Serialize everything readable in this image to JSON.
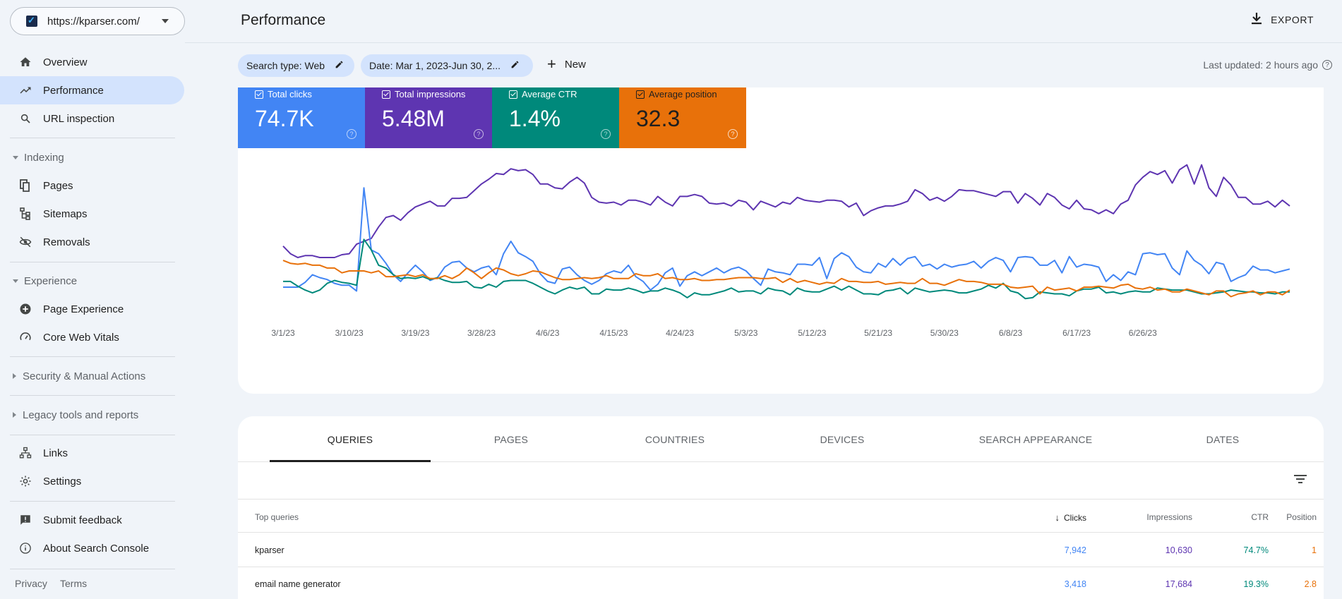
{
  "sidebar": {
    "property_url": "https://kparser.com/",
    "items_top": [
      {
        "label": "Overview",
        "icon": "home-icon"
      },
      {
        "label": "Performance",
        "icon": "trending-up-icon",
        "active": true
      },
      {
        "label": "URL inspection",
        "icon": "search-icon"
      }
    ],
    "indexing": {
      "header": "Indexing",
      "items": [
        {
          "label": "Pages",
          "icon": "pages-icon"
        },
        {
          "label": "Sitemaps",
          "icon": "sitemap-icon"
        },
        {
          "label": "Removals",
          "icon": "visibility-off-icon"
        }
      ]
    },
    "experience": {
      "header": "Experience",
      "items": [
        {
          "label": "Page Experience",
          "icon": "plus-circle-icon"
        },
        {
          "label": "Core Web Vitals",
          "icon": "gauge-icon"
        }
      ]
    },
    "security_header": "Security & Manual Actions",
    "legacy_header": "Legacy tools and reports",
    "items_bottom": [
      {
        "label": "Links",
        "icon": "links-icon"
      },
      {
        "label": "Settings",
        "icon": "gear-icon"
      }
    ],
    "items_footer": [
      {
        "label": "Submit feedback",
        "icon": "feedback-icon"
      },
      {
        "label": "About Search Console",
        "icon": "info-icon"
      }
    ],
    "privacy": "Privacy",
    "terms": "Terms"
  },
  "header": {
    "title": "Performance",
    "export_label": "EXPORT"
  },
  "filters": {
    "search_type": "Search type: Web",
    "date": "Date: Mar 1, 2023-Jun 30, 2...",
    "new_label": "New",
    "last_updated": "Last updated: 2 hours ago"
  },
  "metrics": [
    {
      "label": "Total clicks",
      "value": "74.7K",
      "color": "#4285f4"
    },
    {
      "label": "Total impressions",
      "value": "5.48M",
      "color": "#5e35b1"
    },
    {
      "label": "Average CTR",
      "value": "1.4%",
      "color": "#00897b"
    },
    {
      "label": "Average position",
      "value": "32.3",
      "color": "#e8710a"
    }
  ],
  "chart_data": {
    "type": "line",
    "x_labels": [
      "3/1/23",
      "3/10/23",
      "3/19/23",
      "3/28/23",
      "4/6/23",
      "4/15/23",
      "4/24/23",
      "5/3/23",
      "5/12/23",
      "5/21/23",
      "5/30/23",
      "6/8/23",
      "6/17/23",
      "6/26/23"
    ],
    "x_range": [
      "3/1/23",
      "6/30/23"
    ],
    "y_axis_labels_shown": false,
    "grid": false,
    "series": [
      {
        "name": "Total impressions",
        "color": "#5e35b1",
        "values": [
          60,
          52,
          48,
          50,
          50,
          48,
          48,
          48,
          51,
          52,
          62,
          65,
          68,
          80,
          90,
          92,
          87,
          95,
          101,
          104,
          107,
          102,
          102,
          110,
          110,
          111,
          118,
          125,
          130,
          136,
          135,
          141,
          139,
          140,
          135,
          125,
          125,
          121,
          120,
          127,
          132,
          126,
          111,
          106,
          105,
          106,
          103,
          108,
          108,
          106,
          103,
          112,
          106,
          102,
          112,
          112,
          114,
          112,
          105,
          104,
          105,
          102,
          108,
          106,
          98,
          107,
          104,
          101,
          106,
          104,
          111,
          108,
          107,
          106,
          108,
          108,
          107,
          101,
          105,
          92,
          97,
          100,
          102,
          102,
          104,
          107,
          119,
          115,
          108,
          111,
          107,
          112,
          119,
          118,
          118,
          116,
          114,
          112,
          117,
          117,
          105,
          115,
          110,
          103,
          115,
          111,
          103,
          99,
          108,
          99,
          98,
          94,
          98,
          94,
          104,
          108,
          124,
          132,
          138,
          135,
          139,
          126,
          140,
          145,
          125,
          145,
          121,
          112,
          132,
          124,
          111,
          111,
          104,
          104,
          107,
          101,
          108,
          102
        ]
      },
      {
        "name": "Total clicks",
        "color": "#4285f4",
        "values": [
          17,
          17,
          17,
          22,
          30,
          27,
          25,
          21,
          19,
          19,
          13,
          121,
          56,
          52,
          42,
          30,
          23,
          32,
          40,
          33,
          24,
          27,
          38,
          43,
          44,
          37,
          33,
          37,
          39,
          30,
          52,
          65,
          53,
          49,
          44,
          31,
          23,
          21,
          36,
          38,
          30,
          24,
          20,
          24,
          31,
          34,
          32,
          40,
          28,
          23,
          14,
          20,
          32,
          37,
          18,
          29,
          33,
          29,
          33,
          37,
          32,
          36,
          38,
          34,
          26,
          19,
          36,
          33,
          32,
          30,
          41,
          41,
          40,
          48,
          26,
          47,
          53,
          49,
          38,
          33,
          32,
          42,
          38,
          47,
          40,
          47,
          49,
          39,
          41,
          36,
          41,
          38,
          40,
          41,
          44,
          37,
          44,
          48,
          45,
          33,
          48,
          49,
          48,
          40,
          40,
          45,
          32,
          49,
          38,
          41,
          40,
          38,
          23,
          30,
          24,
          33,
          30,
          52,
          53,
          51,
          52,
          37,
          30,
          55,
          45,
          40,
          31,
          43,
          41,
          23,
          27,
          30,
          39,
          35,
          35,
          32,
          34,
          36
        ]
      },
      {
        "name": "Average CTR",
        "color": "#00897b",
        "values": [
          23,
          23,
          18,
          14,
          11,
          14,
          21,
          24,
          22,
          21,
          19,
          67,
          56,
          40,
          37,
          30,
          26,
          27,
          26,
          28,
          25,
          27,
          24,
          22,
          22,
          23,
          17,
          16,
          20,
          17,
          23,
          24,
          24,
          24,
          21,
          17,
          13,
          10,
          14,
          17,
          15,
          17,
          10,
          10,
          15,
          14,
          14,
          16,
          14,
          11,
          13,
          13,
          16,
          14,
          11,
          6,
          11,
          9,
          9,
          11,
          13,
          16,
          12,
          13,
          13,
          10,
          16,
          14,
          13,
          9,
          16,
          13,
          12,
          12,
          15,
          18,
          14,
          18,
          14,
          10,
          10,
          9,
          13,
          14,
          16,
          10,
          16,
          14,
          12,
          13,
          14,
          13,
          11,
          11,
          13,
          15,
          19,
          16,
          21,
          13,
          11,
          5,
          6,
          12,
          11,
          10,
          10,
          8,
          13,
          15,
          15,
          17,
          11,
          12,
          10,
          12,
          13,
          12,
          12,
          16,
          15,
          14,
          14,
          14,
          12,
          10,
          10,
          11,
          12,
          14,
          13,
          12,
          12,
          11,
          11,
          10,
          12,
          12
        ]
      },
      {
        "name": "Average position",
        "color": "#e8710a",
        "values": [
          45,
          42,
          41,
          42,
          40,
          40,
          37,
          37,
          32,
          34,
          34,
          34,
          32,
          34,
          28,
          28,
          29,
          30,
          28,
          30,
          26,
          26,
          29,
          26,
          30,
          37,
          32,
          26,
          32,
          37,
          35,
          31,
          29,
          31,
          34,
          33,
          30,
          27,
          25,
          25,
          26,
          27,
          26,
          27,
          29,
          26,
          26,
          26,
          31,
          29,
          29,
          31,
          26,
          27,
          25,
          25,
          26,
          24,
          24,
          25,
          25,
          26,
          27,
          27,
          27,
          26,
          26,
          27,
          22,
          26,
          22,
          24,
          22,
          20,
          22,
          21,
          26,
          23,
          23,
          22,
          22,
          23,
          20,
          21,
          22,
          21,
          21,
          26,
          21,
          21,
          19,
          22,
          25,
          23,
          23,
          22,
          20,
          20,
          20,
          17,
          16,
          17,
          18,
          10,
          17,
          14,
          15,
          16,
          13,
          17,
          17,
          18,
          17,
          16,
          19,
          20,
          16,
          15,
          17,
          14,
          15,
          12,
          12,
          15,
          13,
          11,
          9,
          13,
          13,
          7,
          10,
          11,
          13,
          9,
          12,
          12,
          9,
          14
        ]
      }
    ]
  },
  "table": {
    "tabs": [
      "QUERIES",
      "PAGES",
      "COUNTRIES",
      "DEVICES",
      "SEARCH APPEARANCE",
      "DATES"
    ],
    "active_tab": "QUERIES",
    "columns": {
      "query": "Top queries",
      "clicks": "Clicks",
      "impressions": "Impressions",
      "ctr": "CTR",
      "position": "Position"
    },
    "rows": [
      {
        "query": "kparser",
        "clicks": "7,942",
        "impressions": "10,630",
        "ctr": "74.7%",
        "position": "1"
      },
      {
        "query": "email name generator",
        "clicks": "3,418",
        "impressions": "17,684",
        "ctr": "19.3%",
        "position": "2.8"
      }
    ]
  }
}
